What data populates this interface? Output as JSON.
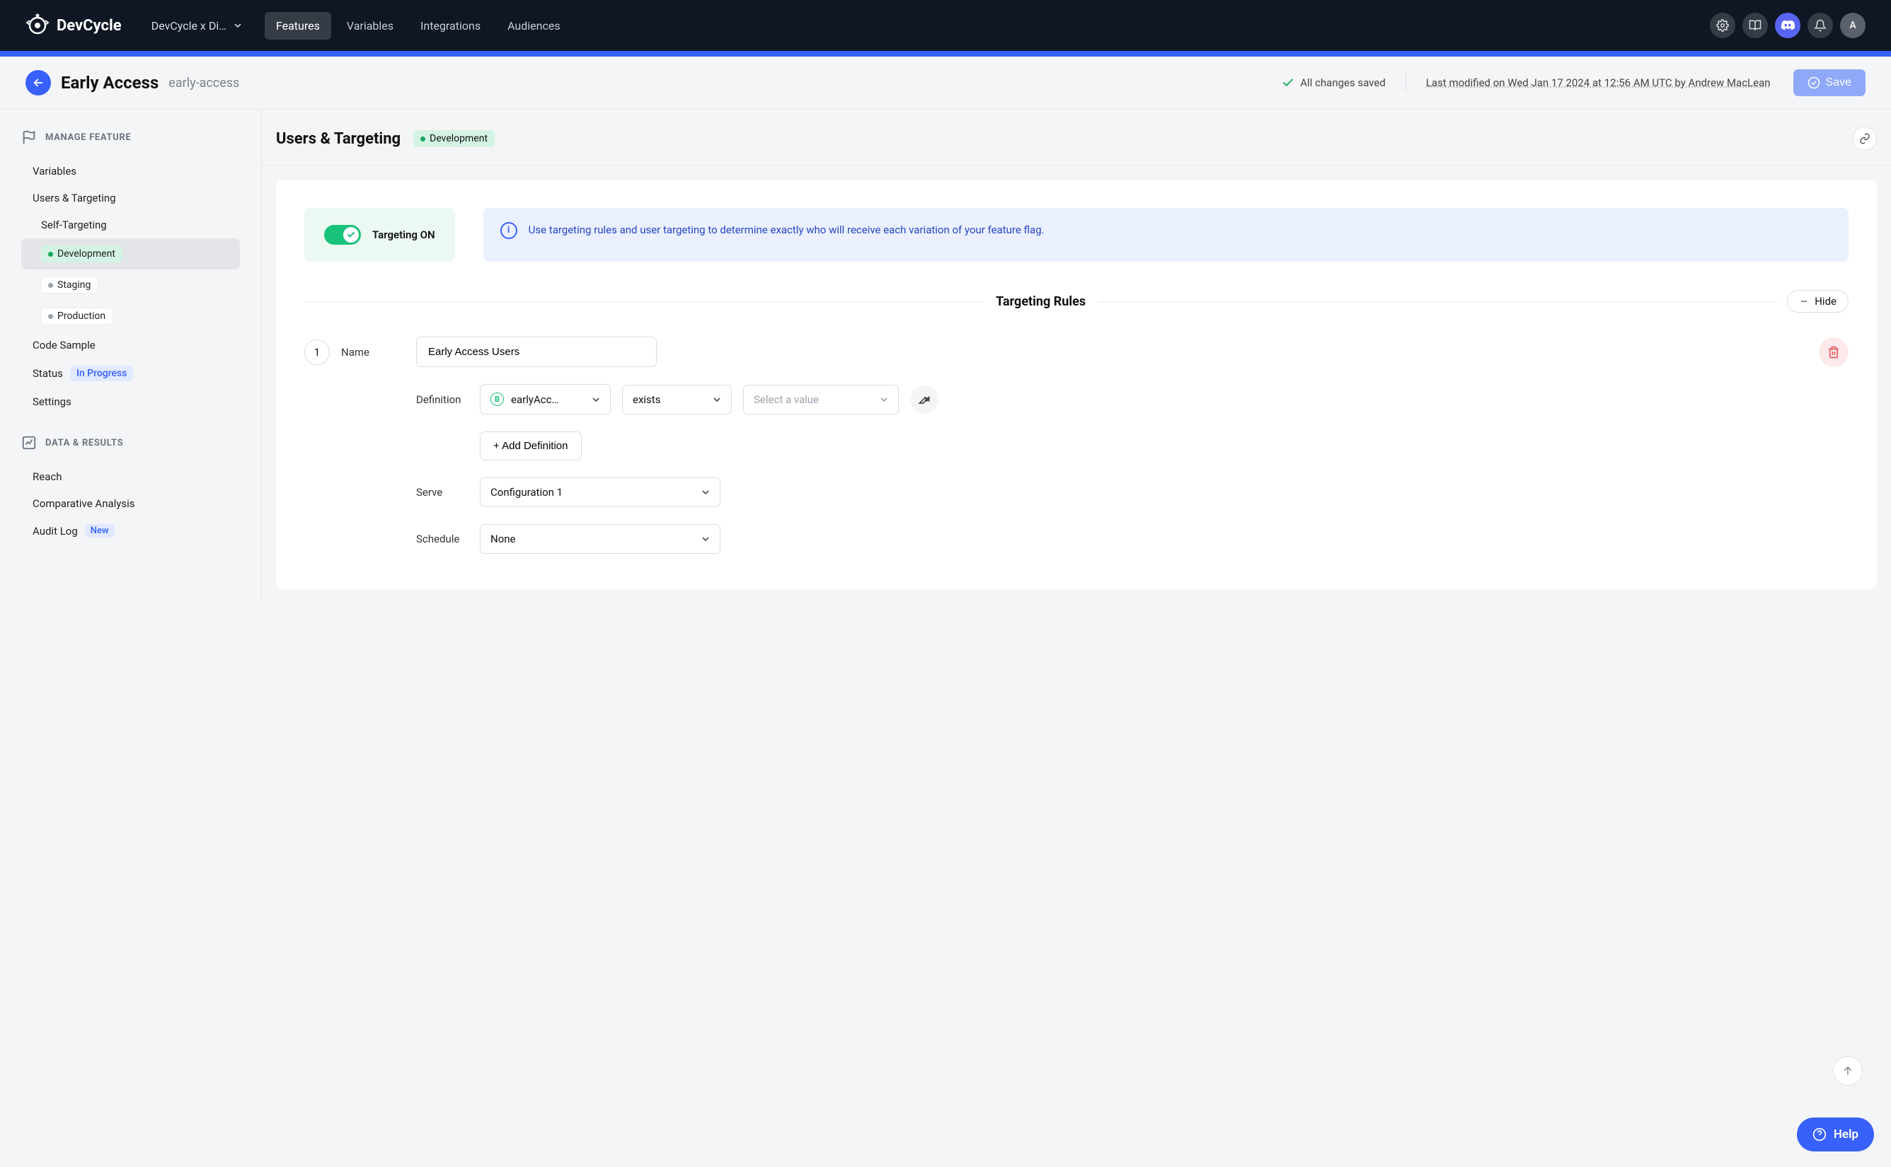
{
  "brand": "DevCycle",
  "project_selector": "DevCycle x Di…",
  "nav": {
    "features": "Features",
    "variables": "Variables",
    "integrations": "Integrations",
    "audiences": "Audiences"
  },
  "avatar_initial": "A",
  "header": {
    "title": "Early Access",
    "key": "early-access",
    "saved": "All changes saved",
    "last_modified": "Last modified on Wed Jan 17 2024 at 12:56 AM UTC by Andrew MacLean",
    "save": "Save"
  },
  "sidebar": {
    "manage_feature": "MANAGE FEATURE",
    "variables": "Variables",
    "users_targeting": "Users & Targeting",
    "self_targeting": "Self-Targeting",
    "development": "Development",
    "staging": "Staging",
    "production": "Production",
    "code_sample": "Code Sample",
    "status": "Status",
    "status_value": "In Progress",
    "settings": "Settings",
    "data_results": "DATA & RESULTS",
    "reach": "Reach",
    "comparative": "Comparative Analysis",
    "audit_log": "Audit Log",
    "new_badge": "New"
  },
  "main": {
    "title": "Users & Targeting",
    "env": "Development",
    "targeting_on": "Targeting ON",
    "info": "Use targeting rules and user targeting to determine exactly who will receive each variation of your feature flag.",
    "rules_title": "Targeting Rules",
    "hide": "Hide",
    "rule": {
      "num": "1",
      "name_label": "Name",
      "name_value": "Early Access Users",
      "definition_label": "Definition",
      "var_value": "earlyAcc…",
      "operator": "exists",
      "value_placeholder": "Select a value",
      "add_definition": "+ Add Definition",
      "serve_label": "Serve",
      "serve_value": "Configuration 1",
      "schedule_label": "Schedule",
      "schedule_value": "None"
    }
  },
  "help": "Help"
}
